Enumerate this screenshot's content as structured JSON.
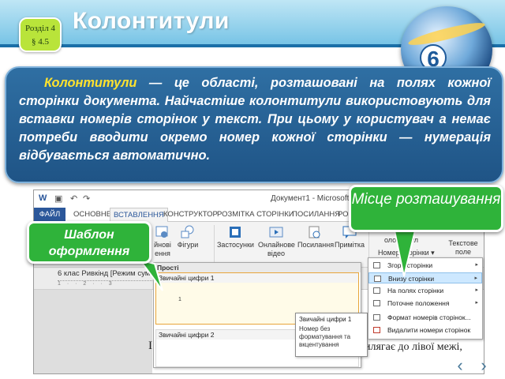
{
  "slide": {
    "title": "Колонтитули",
    "section_badge_line1": "Розділ 4",
    "section_badge_line2": "§ 4.5",
    "grade_number": "6",
    "definition": {
      "term": "Колонтитули",
      "rest": " — це області, розташовані на полях кожної сторінки документа. Найчастіше колонтитули використовують для вставки номерів сторінок у текст. При цьому у користувач а немає потреби вводити окремо номер кожної сторінки — нумерація відбувається автоматично."
    },
    "callouts": {
      "template": "Шаблон оформлення",
      "location": "Місце розташування"
    },
    "nav_prev": "‹",
    "nav_next": "›",
    "colors": {
      "header": "#78c4e6",
      "definition_bg": "#2f6fa3",
      "term": "#ffe22e",
      "callout": "#2fb33a",
      "badge": "#b9e43a"
    }
  },
  "word": {
    "window_title": "Документ1 - Microsoft Word",
    "tabs": [
      "ФАЙЛ",
      "ОСНОВНЕ",
      "ВСТАВЛЕННЯ",
      "КОНСТРУКТОР",
      "РОЗМІТКА СТОРІНКИ",
      "ПОСИЛАННЯ",
      "РОЗСИЛКИ"
    ],
    "active_tab": "ВСТАВЛЕННЯ",
    "ribbon": {
      "btn1": "йнові",
      "btn1b": "ення",
      "btn2": "Фігури",
      "btn3": "Застосунки",
      "btn4": "Онлайнове",
      "btn4b": "відео",
      "btn5": "Посилання",
      "btn6": "Примітка",
      "btn7": "олонтитул",
      "btn8": "Номер сторінки",
      "btn9": "Текстове",
      "btn9b": "поле"
    },
    "font_row": "6 клас Ривкінд [Режим сумісн",
    "ruler_marks": "1 · · 2 · · 3",
    "doc_text_right": "илягає до лівої межі,",
    "doc_text_left": "І",
    "gallery": {
      "header": "Прості",
      "item1": "Звичайні цифри 1",
      "item1_number": "1",
      "item2": "Звичайні цифри 2"
    },
    "tooltip": {
      "title": "Звичайні цифри 1",
      "body": "Номер без форматування та вкцентування"
    },
    "page_number_menu": [
      "Згори сторінки",
      "Внизу сторінки",
      "На полях сторінки",
      "Поточне положення",
      "Формат номерів сторінок...",
      "Видалити номери сторінок"
    ],
    "highlighted_item": "Внизу сторінки"
  }
}
